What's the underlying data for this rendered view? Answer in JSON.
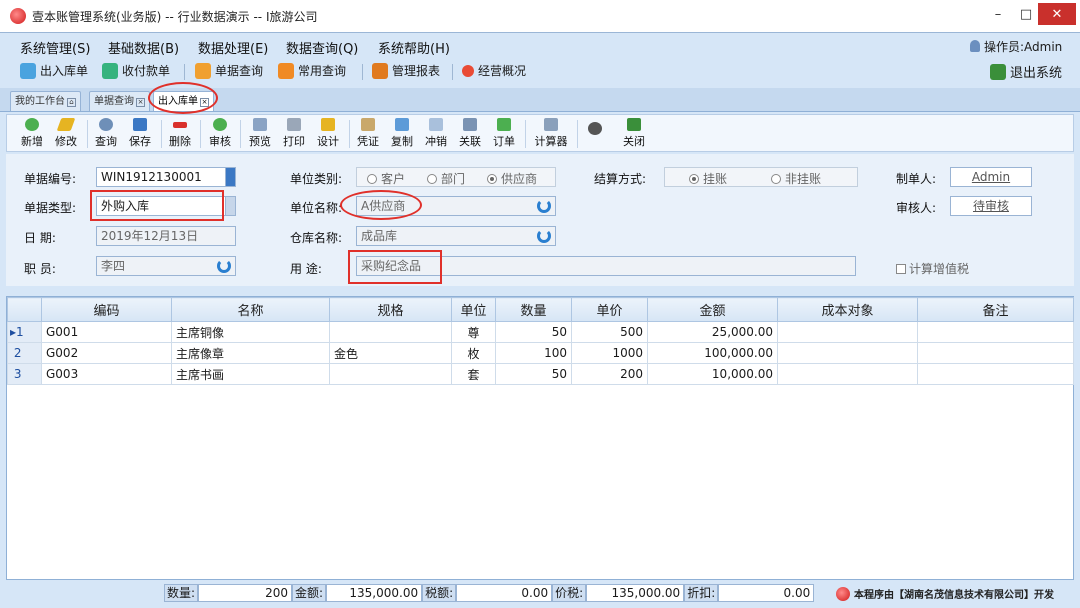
{
  "window": {
    "title": "壹本账管理系统(业务版) -- 行业数据演示 -- I旅游公司"
  },
  "menu": [
    {
      "label": "系统管理(S)"
    },
    {
      "label": "基础数据(B)"
    },
    {
      "label": "数据处理(E)"
    },
    {
      "label": "数据查询(Q)"
    },
    {
      "label": "系统帮助(H)"
    }
  ],
  "operator": "操作员:Admin",
  "quickbar": {
    "items": [
      {
        "label": "出入库单",
        "icon": "stock-doc-icon"
      },
      {
        "label": "收付款单",
        "icon": "payment-icon"
      },
      {
        "label": "单据查询",
        "icon": "doc-query-icon"
      },
      {
        "label": "常用查询",
        "icon": "chart-query-icon"
      },
      {
        "label": "管理报表",
        "icon": "report-icon"
      },
      {
        "label": "经营概况",
        "icon": "overview-icon"
      }
    ],
    "exit": "退出系统"
  },
  "tabs": [
    {
      "label": "我的工作台"
    },
    {
      "label": "单据查询"
    },
    {
      "label": "出入库单"
    }
  ],
  "toolbar": [
    {
      "label": "新增"
    },
    {
      "label": "修改"
    },
    {
      "label": "查询"
    },
    {
      "label": "保存"
    },
    {
      "label": "删除"
    },
    {
      "label": "审核"
    },
    {
      "label": "预览"
    },
    {
      "label": "打印"
    },
    {
      "label": "设计"
    },
    {
      "label": "凭证"
    },
    {
      "label": "复制"
    },
    {
      "label": "冲销"
    },
    {
      "label": "关联"
    },
    {
      "label": "订单"
    },
    {
      "label": "计算器"
    },
    {
      "label": "关闭"
    }
  ],
  "form": {
    "doc_no_label": "单据编号:",
    "doc_no": "WIN1912130001",
    "doc_type_label": "单据类型:",
    "doc_type": "外购入库",
    "date_label": "日    期:",
    "date": "2019年12月13日",
    "staff_label": "职    员:",
    "staff": "李四",
    "unit_type_label": "单位类别:",
    "unit_type_options": [
      "客户",
      "部门",
      "供应商"
    ],
    "unit_type_selected": "供应商",
    "unit_name_label": "单位名称:",
    "unit_name": "A供应商",
    "warehouse_label": "仓库名称:",
    "warehouse": "成品库",
    "purpose_label": "用    途:",
    "purpose": "采购纪念品",
    "settle_label": "结算方式:",
    "settle_options": [
      "挂账",
      "非挂账"
    ],
    "settle_selected": "挂账",
    "maker_label": "制单人:",
    "maker": "Admin",
    "auditor_label": "审核人:",
    "auditor": "待审核",
    "vat_label": "计算增值税"
  },
  "table": {
    "headers": [
      "编码",
      "名称",
      "规格",
      "单位",
      "数量",
      "单价",
      "金额",
      "成本对象",
      "备注"
    ],
    "rows": [
      {
        "no": "1",
        "code": "G001",
        "name": "主席铜像",
        "spec": "",
        "unit": "尊",
        "qty": "50",
        "price": "500",
        "amount": "25,000.00",
        "cost": "",
        "remark": ""
      },
      {
        "no": "2",
        "code": "G002",
        "name": "主席像章",
        "spec": "金色",
        "unit": "枚",
        "qty": "100",
        "price": "1000",
        "amount": "100,000.00",
        "cost": "",
        "remark": ""
      },
      {
        "no": "3",
        "code": "G003",
        "name": "主席书画",
        "spec": "",
        "unit": "套",
        "qty": "50",
        "price": "200",
        "amount": "10,000.00",
        "cost": "",
        "remark": ""
      }
    ]
  },
  "footer": {
    "qty_label": "数量:",
    "qty": "200",
    "amount_label": "金额:",
    "amount": "135,000.00",
    "tax_label": "税额:",
    "tax": "0.00",
    "total_label": "价税:",
    "total": "135,000.00",
    "discount_label": "折扣:",
    "discount": "0.00",
    "credit": "本程序由【湖南名茂信息技术有限公司】开发"
  }
}
